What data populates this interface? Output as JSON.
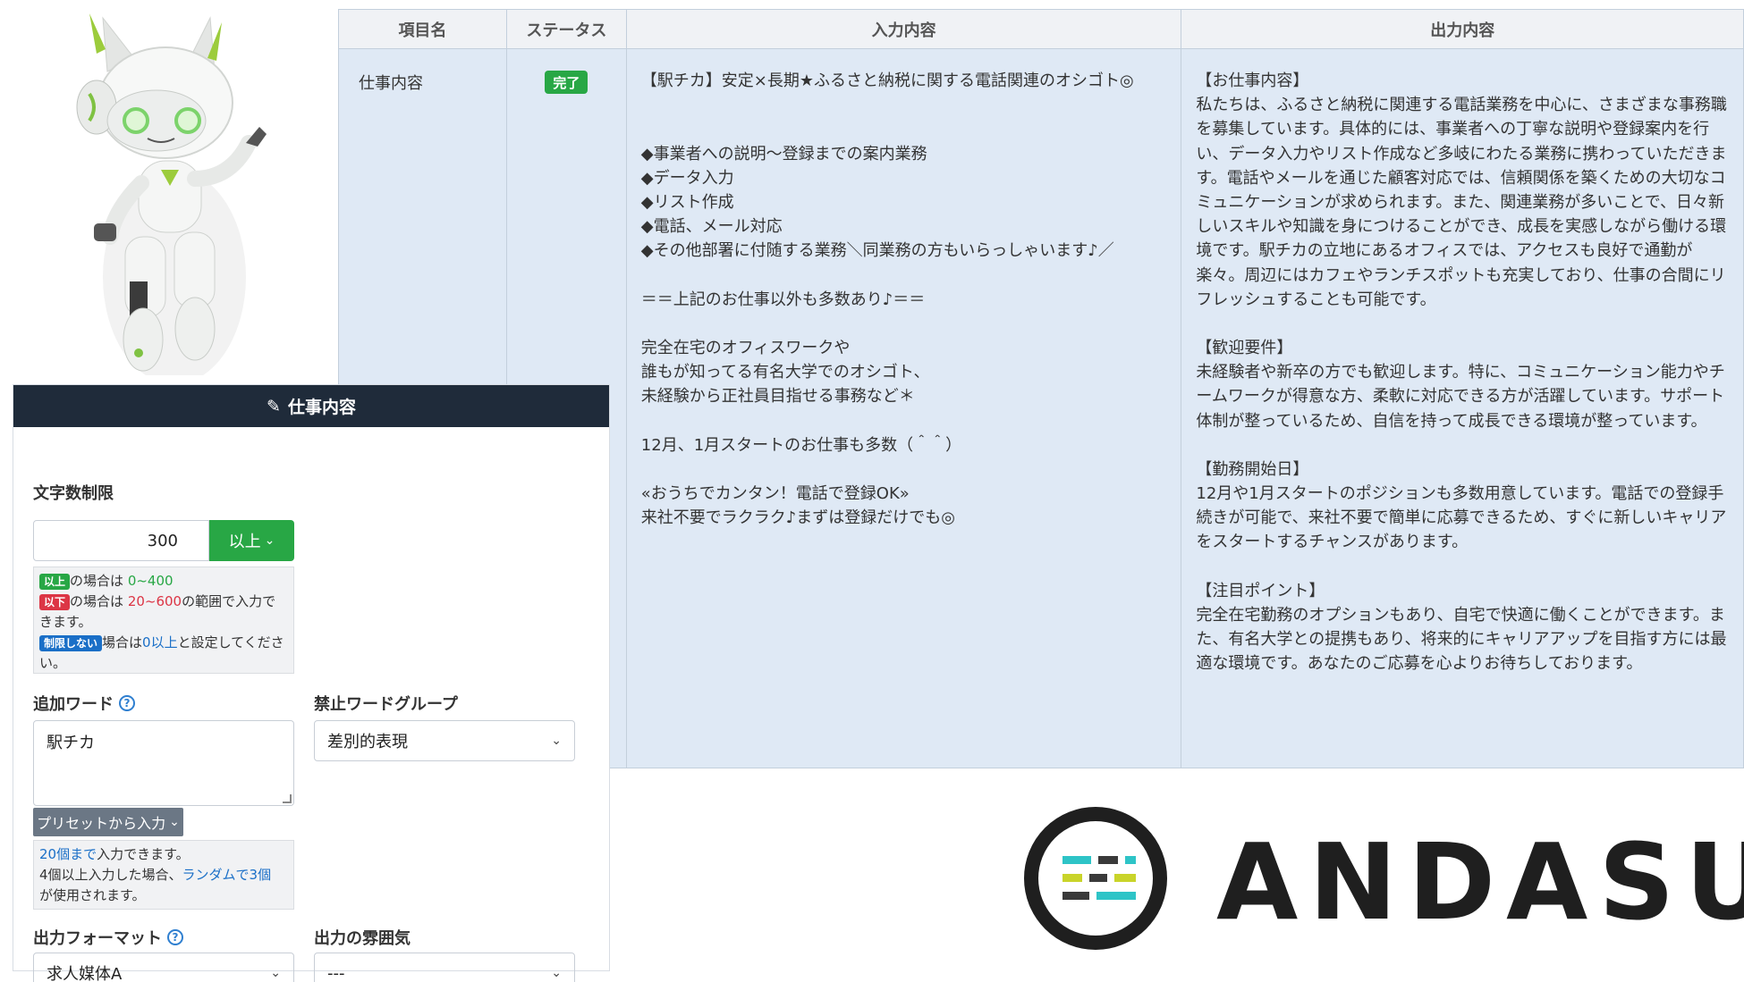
{
  "table": {
    "headers": {
      "item": "項目名",
      "status": "ステータス",
      "input": "入力内容",
      "output": "出力内容"
    },
    "row": {
      "item": "仕事内容",
      "status": "完了",
      "input_lines": [
        "【駅チカ】安定×長期★ふるさと納税に関する電話関連のオシゴト◎",
        "",
        "",
        "◆事業者への説明～登録までの案内業務",
        "◆データ入力",
        "◆リスト作成",
        "◆電話、メール対応",
        "◆その他部署に付随する業務＼同業務の方もいらっしゃいます♪／",
        "",
        "＝＝上記のお仕事以外も多数あり♪＝＝",
        "",
        "完全在宅のオフィスワークや",
        "誰もが知ってる有名大学でのオシゴト、",
        "未経験から正社員目指せる事務など＊",
        "",
        "12月、1月スタートのお仕事も多数（＾＾）",
        "",
        "«おうちでカンタン！電話で登録OK»",
        "来社不要でラクラク♪まずは登録だけでも◎"
      ],
      "output_paragraphs": [
        "【お仕事内容】 私たちは、ふるさと納税に関連する電話業務を中心に、さまざまな事務職を募集しています。具体的には、事業者への丁寧な説明や登録案内を行い、データ入力やリスト作成など多岐にわたる業務に携わっていただきます。電話やメールを通じた顧客対応では、信頼関係を築くための大切なコミュニケーションが求められます。また、関連業務が多いことで、日々新しいスキルや知識を身につけることができ、成長を実感しながら働ける環境です。駅チカの立地にあるオフィスでは、アクセスも良好で通勤が楽々。周辺にはカフェやランチスポットも充実しており、仕事の合間にリフレッシュすることも可能です。",
        "【歓迎要件】 未経験者や新卒の方でも歓迎します。特に、コミュニケーション能力やチームワークが得意な方、柔軟に対応できる方が活躍しています。サポート体制が整っているため、自信を持って成長できる環境が整っています。",
        "【勤務開始日】 12月や1月スタートのポジションも多数用意しています。電話での登録手続きが可能で、来社不要で簡単に応募できるため、すぐに新しいキャリアをスタートするチャンスがあります。",
        "【注目ポイント】 完全在宅勤務のオプションもあり、自宅で快適に働くことができます。また、有名大学との提携もあり、将来的にキャリアアップを目指す方には最適な環境です。あなたのご応募を心よりお待ちしております。"
      ]
    }
  },
  "panel": {
    "title": "仕事内容",
    "char_limit": {
      "label": "文字数制限",
      "value": "300",
      "mode": "以上",
      "note": {
        "tag_above": "以上",
        "text1": "の場合は",
        "range_above": "0~400",
        "tag_below": "以下",
        "text2": "の場合は",
        "range_below": "20~600",
        "text3": "の範囲で入力できます。",
        "tag_none": "制限しない",
        "text4": "場合は",
        "none_value": "0以上",
        "text5": "と設定してください。"
      }
    },
    "add_words": {
      "label": "追加ワード",
      "value": "駅チカ",
      "preset_button": "プリセットから入力",
      "note": {
        "max": "20個まで",
        "text1": "入力できます。",
        "text2": "4個以上入力した場合、",
        "random": "ランダムで3個",
        "text3": "が使用されます。"
      }
    },
    "banned_group": {
      "label": "禁止ワードグループ",
      "value": "差別的表現"
    },
    "output_format": {
      "label": "出力フォーマット",
      "value": "求人媒体A"
    },
    "output_mood": {
      "label": "出力の雰囲気",
      "value": "---"
    }
  },
  "logo": {
    "text": "ANDASU"
  },
  "colors": {
    "success": "#28a745",
    "danger": "#dc3545",
    "link": "#1a6fc7",
    "panel_header": "#1f2b3a",
    "row_bg": "#dfe9f5"
  }
}
